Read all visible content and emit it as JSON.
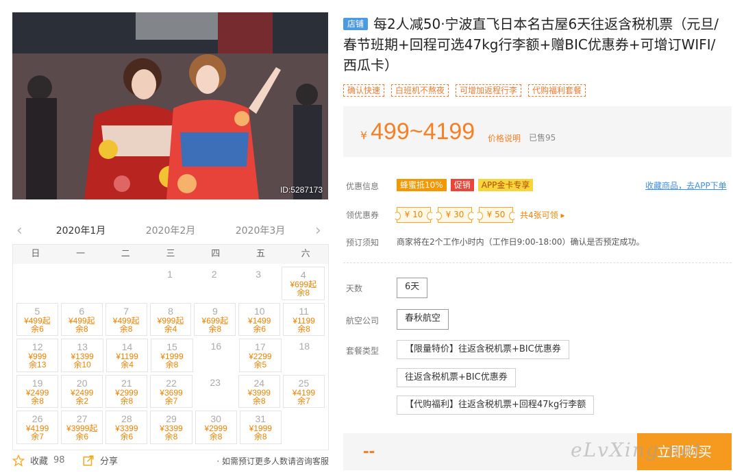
{
  "photo": {
    "id_label": "ID:5287173"
  },
  "calendar": {
    "months": [
      "2020年1月",
      "2020年2月",
      "2020年3月"
    ],
    "weekdays": [
      "日",
      "一",
      "二",
      "三",
      "四",
      "五",
      "六"
    ],
    "weeks": [
      [
        null,
        null,
        null,
        {
          "d": "1"
        },
        {
          "d": "2"
        },
        {
          "d": "3"
        },
        {
          "d": "4",
          "p": "¥699起",
          "r": "余8"
        }
      ],
      [
        {
          "d": "5",
          "p": "¥499起",
          "r": "余6"
        },
        {
          "d": "6",
          "p": "¥499起",
          "r": "余8"
        },
        {
          "d": "7",
          "p": "¥499起",
          "r": "余8"
        },
        {
          "d": "8",
          "p": "¥999起",
          "r": "余4"
        },
        {
          "d": "9",
          "p": "¥699起",
          "r": "余8"
        },
        {
          "d": "10",
          "p": "¥1499",
          "r": "余6"
        },
        {
          "d": "11",
          "p": "¥1199",
          "r": "余8"
        }
      ],
      [
        {
          "d": "12",
          "p": "¥999",
          "r": "余13"
        },
        {
          "d": "13",
          "p": "¥1399",
          "r": "余10"
        },
        {
          "d": "14",
          "p": "¥1199",
          "r": "余4"
        },
        {
          "d": "15",
          "p": "¥1999",
          "r": "余8"
        },
        {
          "d": "16"
        },
        {
          "d": "17",
          "p": "¥2299",
          "r": "余5"
        },
        {
          "d": "18"
        }
      ],
      [
        {
          "d": "19",
          "p": "¥2499",
          "r": "余8"
        },
        {
          "d": "20",
          "p": "¥2499",
          "r": "余2"
        },
        {
          "d": "21",
          "p": "¥2999",
          "r": "余8"
        },
        {
          "d": "22",
          "p": "¥3699",
          "r": "余7"
        },
        {
          "d": "23"
        },
        {
          "d": "24",
          "p": "¥3999",
          "r": "余8"
        },
        {
          "d": "25",
          "p": "¥4199",
          "r": "余7"
        }
      ],
      [
        {
          "d": "26",
          "p": "¥4199",
          "r": "余7"
        },
        {
          "d": "27",
          "p": "¥3999起",
          "r": "余6"
        },
        {
          "d": "28",
          "p": "¥3399",
          "r": "余6"
        },
        {
          "d": "29",
          "p": "¥3399",
          "r": "余8"
        },
        {
          "d": "30",
          "p": "¥2999",
          "r": "余8"
        },
        {
          "d": "31",
          "p": "¥1999",
          "r": "余8"
        },
        null
      ]
    ]
  },
  "actions": {
    "favorite_label": "收藏",
    "favorite_count": "98",
    "share_label": "分享",
    "note": "· 如需预订更多人数请咨询客服"
  },
  "product": {
    "shop_badge": "店铺",
    "title": "每2人减50·宁波直飞日本名古屋6天往返含税机票（元旦/春节班期+回程可选47kg行李额+赠BIC优惠券+可增订WIFI/西瓜卡）",
    "tags": [
      "确认快速",
      "白班机不熬夜",
      "可增加返程行李",
      "代购福利套餐"
    ]
  },
  "price": {
    "currency": "¥",
    "range": "499~4199",
    "explain_label": "价格说明",
    "sold": "已售95"
  },
  "promo": {
    "label": "优惠信息",
    "tags": [
      "蜂蜜抵10%",
      "促销",
      "APP金卡专享"
    ],
    "fav_app_link": "收藏商品，去APP下单"
  },
  "coupons": {
    "label": "领优惠券",
    "items": [
      "¥ 10",
      "¥ 30",
      "¥ 50"
    ],
    "more": "共4张可领 ▸"
  },
  "booking": {
    "label": "预订须知",
    "text": "商家将在2个工作小时内（工作日9:00-18:00）确认是否预定成功。"
  },
  "options": {
    "days_label": "天数",
    "days": "6天",
    "airline_label": "航空公司",
    "airline": "春秋航空",
    "package_label": "套餐类型",
    "packages": [
      "【限量特价】往返含税机票+BIC优惠券",
      "往返含税机票+BIC优惠券",
      "【代购福利】往返含税机票+回程47kg行李额"
    ]
  },
  "buy": {
    "price_placeholder": "--",
    "button_label": "立即购买",
    "watermark": "eLvXing.net"
  },
  "colors": {
    "accent": "#f58025",
    "button": "#f59a1f",
    "link": "#3f8fe0"
  }
}
